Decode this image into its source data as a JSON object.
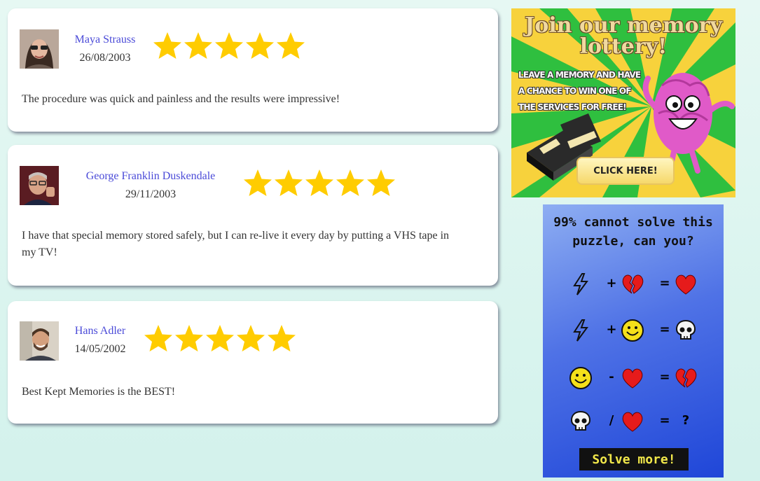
{
  "reviews": [
    {
      "name": "Maya Strauss",
      "date": "26/08/2003",
      "rating": 5,
      "text": "The procedure was quick and painless and the results were impressive!"
    },
    {
      "name": "George Franklin Duskendale",
      "date": "29/11/2003",
      "rating": 5,
      "text": "I have that special memory stored safely, but I can re-live it every day by putting a VHS tape in my TV!"
    },
    {
      "name": "Hans Adler",
      "date": "14/05/2002",
      "rating": 5,
      "text": "Best Kept Memories is the BEST!"
    }
  ],
  "ads": {
    "lottery": {
      "title": "Join our memory lottery!",
      "subtitle": "LEAVE A MEMORY AND HAVE A CHANCE TO WIN ONE OF THE SERVICES FOR FREE!",
      "cta": "CLICK HERE!"
    },
    "puzzle": {
      "title": "99% cannot solve this puzzle, can you?",
      "equations": [
        {
          "items": [
            "lightning-icon",
            "+",
            "broken-heart-icon",
            "=",
            "heart-icon"
          ]
        },
        {
          "items": [
            "lightning-icon",
            "+",
            "smiley-icon",
            "=",
            "skull-icon"
          ]
        },
        {
          "items": [
            "smiley-icon",
            "-",
            "heart-icon",
            "=",
            "broken-heart-icon"
          ]
        },
        {
          "items": [
            "skull-icon",
            "/",
            "heart-icon",
            "=",
            "?"
          ]
        }
      ],
      "cta": "Solve more!"
    }
  },
  "colors": {
    "star": "#ffcc00",
    "name_link": "#4a4ad8",
    "lottery_green": "#2fbf3f",
    "lottery_yellow": "#f7d23c",
    "puzzle_blue": "#2448d8",
    "solve_text": "#f2e84a"
  }
}
